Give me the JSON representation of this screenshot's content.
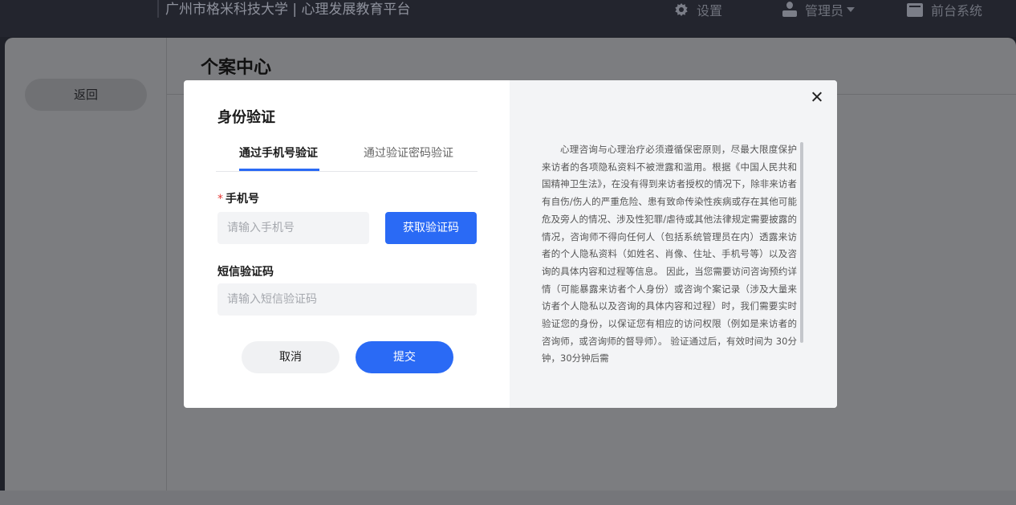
{
  "topbar": {
    "title": "广州市格米科技大学 | 心理发展教育平台",
    "settings_label": "设置",
    "admin_label": "管理员",
    "front_label": "前台系统",
    "icons": [
      "gear-icon",
      "user-icon",
      "caret-down-icon",
      "monitor-icon"
    ]
  },
  "page": {
    "back_label": "返回",
    "title": "个案中心"
  },
  "dialog": {
    "title": "身份验证",
    "tabs": [
      {
        "label": "通过手机号验证",
        "active": true
      },
      {
        "label": "通过验证密码验证",
        "active": false
      }
    ],
    "phone_label": "手机号",
    "phone_required_mark": "*",
    "phone_placeholder": "请输入手机号",
    "get_code_label": "获取验证码",
    "sms_label": "短信验证码",
    "sms_placeholder": "请输入短信验证码",
    "cancel_label": "取消",
    "submit_label": "提交",
    "notice": "心理咨询与心理治疗必须遵循保密原则，尽最大限度保护来访者的各项隐私资料不被泄露和滥用。根据《中国人民共和国精神卫生法》，在没有得到来访者授权的情况下，除非来访者有自伤/伤人的严重危险、患有致命传染性疾病或存在其他可能危及旁人的情况、涉及性犯罪/虐待或其他法律规定需要披露的情况，咨询师不得向任何人（包括系统管理员在内）透露来访者的个人隐私资料（如姓名、肖像、住址、手机号等）以及咨询的具体内容和过程等信息。 因此，当您需要访问咨询预约详情（可能暴露来访者个人身份）或咨询个案记录（涉及大量来访者个人隐私以及咨询的具体内容和过程）时，我们需要实时验证您的身份，以保证您有相应的访问权限（例如是来访者的咨询师，或咨询师的督导师）。 验证通过后，有效时间为 30分钟，30分钟后需"
  },
  "colors": {
    "primary": "#2a6af5",
    "topbar_bg": "#23252e",
    "required": "#e53935"
  }
}
